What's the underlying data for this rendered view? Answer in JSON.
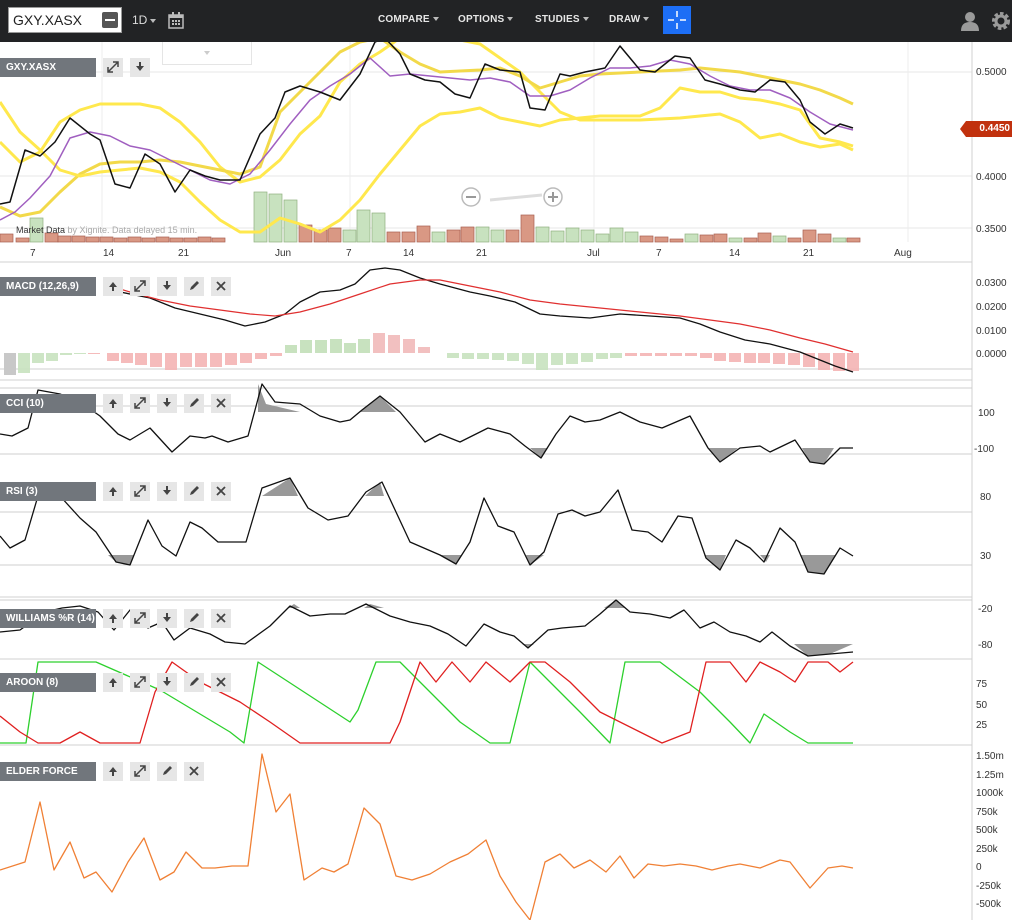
{
  "toolbar": {
    "symbol_value": "GXY.XASX",
    "periodicity": "1D",
    "menu": [
      "COMPARE",
      "OPTIONS",
      "STUDIES",
      "DRAW"
    ]
  },
  "main_chart": {
    "label": "GXY.XASX",
    "price_ticks": [
      "0.5000",
      "0.4500",
      "0.4000",
      "0.3500"
    ],
    "current_price": "0.4450",
    "date_ticks": [
      "7",
      "14",
      "21",
      "Jun",
      "7",
      "14",
      "21",
      "Jul",
      "7",
      "14",
      "21",
      "Aug"
    ],
    "notice_prefix": "Market Data",
    "notice_by": " by Xignite. Data delayed 15 min."
  },
  "panels": {
    "macd": {
      "label": "MACD (12,26,9)",
      "ticks": [
        "0.0300",
        "0.0200",
        "0.0100",
        "0.0000"
      ]
    },
    "cci": {
      "label": "CCI (10)",
      "ticks": [
        "100",
        "-100"
      ]
    },
    "rsi": {
      "label": "RSI (3)",
      "ticks": [
        "80",
        "30"
      ]
    },
    "williams": {
      "label": "WILLIAMS %R (14)",
      "ticks": [
        "-20",
        "-80"
      ]
    },
    "aroon": {
      "label": "AROON (8)",
      "ticks": [
        "75",
        "50",
        "25"
      ]
    },
    "elder": {
      "label": "ELDER FORCE",
      "ticks": [
        "1.50m",
        "1.25m",
        "1000k",
        "750k",
        "500k",
        "250k",
        "0",
        "-250k",
        "-500k"
      ]
    }
  },
  "colors": {
    "toolbar_bg": "#222325",
    "accent_blue": "#1d6ef5",
    "price_tag": "#c1310e",
    "bollinger": "#ffe84d",
    "sma": "#a05fc0",
    "macd_signal": "#e03030",
    "vol_up": "#c8e2bf",
    "vol_down": "#d99884",
    "aroon_up": "#2dd02d",
    "aroon_down": "#e02020",
    "elder": "#f08035"
  }
}
